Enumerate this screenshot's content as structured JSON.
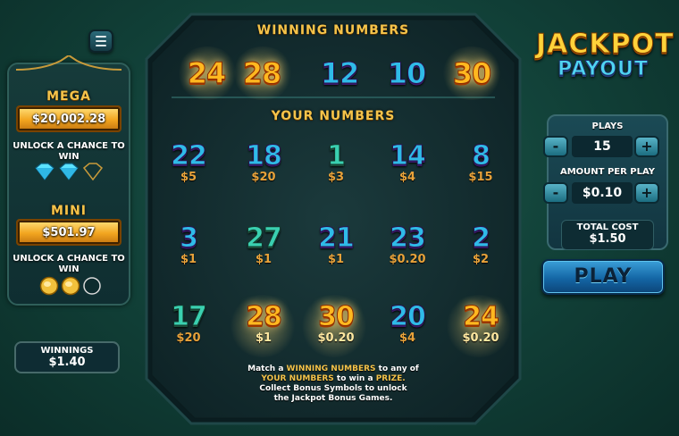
{
  "menu": {
    "icon": "hamburger-menu-icon"
  },
  "jackpots": {
    "mega": {
      "label": "MEGA",
      "amount": "$20,002.28",
      "unlock": "UNLOCK A CHANCE TO WIN",
      "symbol": "diamond-icon",
      "collected": 2,
      "total": 3
    },
    "mini": {
      "label": "MINI",
      "amount": "$501.97",
      "unlock": "UNLOCK A CHANCE TO WIN",
      "symbol": "coin-icon",
      "collected": 2,
      "total": 3
    }
  },
  "winnings": {
    "label": "WINNINGS",
    "value": "$1.40"
  },
  "board": {
    "winning_title": "WINNING NUMBERS",
    "your_title": "YOUR NUMBERS",
    "winning_numbers": [
      "24",
      "28",
      "12",
      "10",
      "30"
    ],
    "winning_styles": [
      "gold",
      "gold",
      "blue",
      "blue",
      "gold"
    ],
    "your_numbers": [
      [
        {
          "n": "22",
          "p": "$5",
          "s": "blue"
        },
        {
          "n": "18",
          "p": "$20",
          "s": "blue"
        },
        {
          "n": "1",
          "p": "$3",
          "s": "teal"
        },
        {
          "n": "14",
          "p": "$4",
          "s": "blue"
        },
        {
          "n": "8",
          "p": "$15",
          "s": "blue"
        }
      ],
      [
        {
          "n": "3",
          "p": "$1",
          "s": "blue"
        },
        {
          "n": "27",
          "p": "$1",
          "s": "teal"
        },
        {
          "n": "21",
          "p": "$1",
          "s": "blue"
        },
        {
          "n": "23",
          "p": "$0.20",
          "s": "blue"
        },
        {
          "n": "2",
          "p": "$2",
          "s": "blue"
        }
      ],
      [
        {
          "n": "17",
          "p": "$20",
          "s": "teal"
        },
        {
          "n": "28",
          "p": "$1",
          "s": "gold"
        },
        {
          "n": "30",
          "p": "$0.20",
          "s": "gold"
        },
        {
          "n": "20",
          "p": "$4",
          "s": "blue"
        },
        {
          "n": "24",
          "p": "$0.20",
          "s": "gold"
        }
      ]
    ],
    "instructions": {
      "l1a": "Match a ",
      "l1b": "WINNING NUMBERS",
      "l1c": " to any of",
      "l2a": "YOUR NUMBERS",
      "l2b": " to win a ",
      "l2c": "PRIZE.",
      "l3": "Collect Bonus Symbols to unlock",
      "l4": "the Jackpot Bonus Games."
    }
  },
  "logo": {
    "line1": "JACKPOT",
    "line2": "PAYOUT"
  },
  "controls": {
    "plays_label": "PLAYS",
    "plays_value": "15",
    "amount_label": "AMOUNT PER PLAY",
    "amount_value": "$0.10",
    "minus": "-",
    "plus": "+",
    "total_label": "TOTAL COST",
    "total_value": "$1.50",
    "play_label": "PLAY"
  },
  "colors": {
    "gold": "#f4c34a",
    "blue_num": "#2fbbe8",
    "teal_num": "#3ad0b0",
    "prize": "#e8a23a",
    "play_btn": "#1466a5"
  }
}
